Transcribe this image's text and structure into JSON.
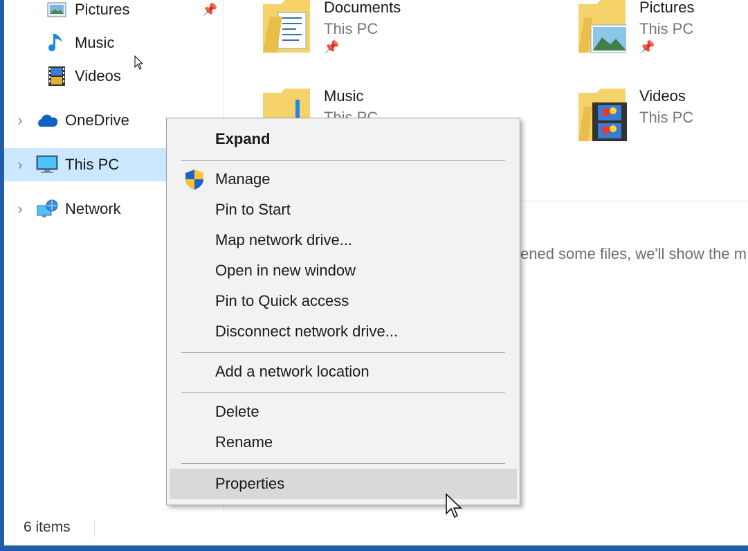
{
  "nav": {
    "items": [
      {
        "label": "Pictures",
        "icon": "pictures-icon"
      },
      {
        "label": "Music",
        "icon": "music-icon"
      },
      {
        "label": "Videos",
        "icon": "videos-icon"
      },
      {
        "label": "OneDrive",
        "icon": "onedrive-icon"
      },
      {
        "label": "This PC",
        "icon": "this-pc-icon"
      },
      {
        "label": "Network",
        "icon": "network-icon"
      }
    ]
  },
  "content": {
    "tiles": [
      {
        "title": "Documents",
        "subtitle": "This PC",
        "pinned": true
      },
      {
        "title": "Pictures",
        "subtitle": "This PC",
        "pinned": true
      },
      {
        "title": "Music",
        "subtitle": "This PC",
        "pinned": false
      },
      {
        "title": "Videos",
        "subtitle": "This PC",
        "pinned": false
      }
    ],
    "recent_message": "ened some files, we'll show the m"
  },
  "status_bar": {
    "item_count": "6 items"
  },
  "context_menu": {
    "items": [
      {
        "label": "Expand"
      },
      {
        "label": "Manage"
      },
      {
        "label": "Pin to Start"
      },
      {
        "label": "Map network drive..."
      },
      {
        "label": "Open in new window"
      },
      {
        "label": "Pin to Quick access"
      },
      {
        "label": "Disconnect network drive..."
      },
      {
        "label": "Add a network location"
      },
      {
        "label": "Delete"
      },
      {
        "label": "Rename"
      },
      {
        "label": "Properties"
      }
    ]
  },
  "colors": {
    "accent": "#1f5da8",
    "selection": "#cce8ff",
    "menu_bg": "#f2f2f2",
    "menu_highlight": "#d9d9d9",
    "folder": "#f6d26b"
  }
}
